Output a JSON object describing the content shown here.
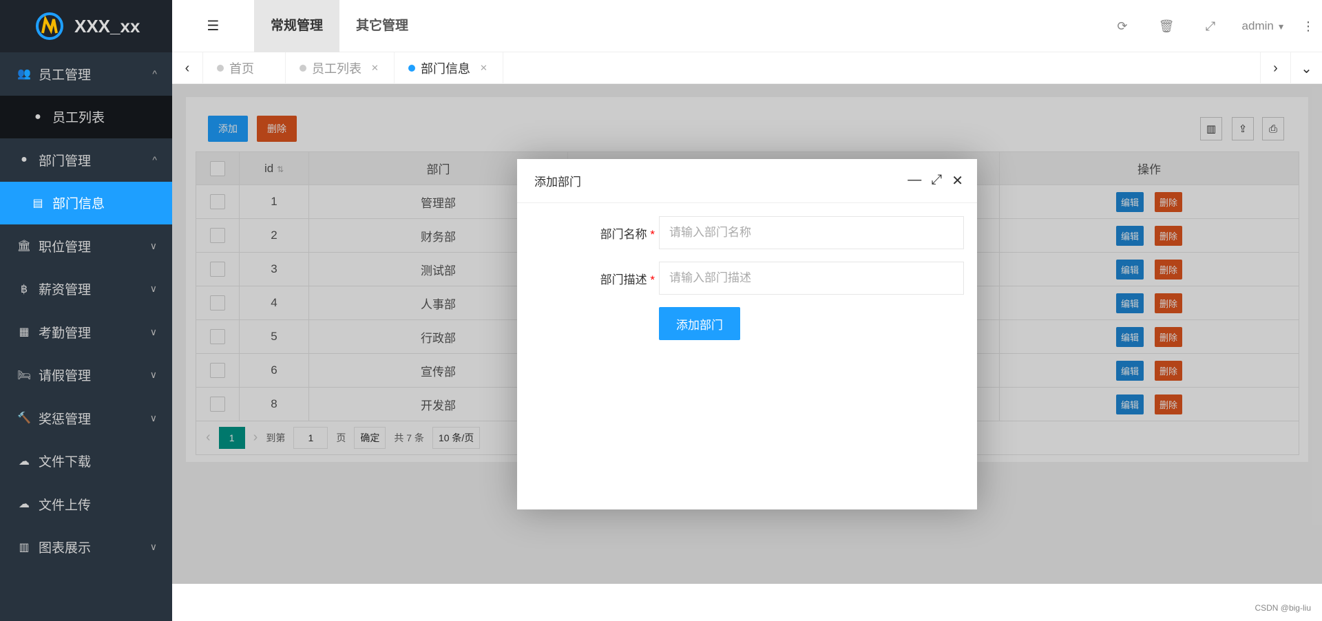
{
  "app": {
    "title": "XXX_xx"
  },
  "sidebar": {
    "items": [
      {
        "label": "员工管理",
        "icon": "users-icon",
        "glyph": "👥",
        "chevron": "^",
        "sub": false
      },
      {
        "label": "员工列表",
        "icon": "user-icon",
        "glyph": "●",
        "sub": true
      },
      {
        "label": "部门管理",
        "icon": "user-icon",
        "glyph": "●",
        "chevron": "^",
        "sub": false
      },
      {
        "label": "部门信息",
        "icon": "list-icon",
        "glyph": "▤",
        "sub": true,
        "active": true
      },
      {
        "label": "职位管理",
        "icon": "bank-icon",
        "glyph": "🏛",
        "chevron": "∨"
      },
      {
        "label": "薪资管理",
        "icon": "bitcoin-icon",
        "glyph": "฿",
        "chevron": "∨"
      },
      {
        "label": "考勤管理",
        "icon": "calendar-icon",
        "glyph": "▦",
        "chevron": "∨"
      },
      {
        "label": "请假管理",
        "icon": "bed-icon",
        "glyph": "🛏",
        "chevron": "∨"
      },
      {
        "label": "奖惩管理",
        "icon": "gavel-icon",
        "glyph": "🔨",
        "chevron": "∨"
      },
      {
        "label": "文件下载",
        "icon": "cloud-download-icon",
        "glyph": "☁"
      },
      {
        "label": "文件上传",
        "icon": "cloud-upload-icon",
        "glyph": "☁"
      },
      {
        "label": "图表展示",
        "icon": "bar-chart-icon",
        "glyph": "▥",
        "chevron": "∨"
      }
    ]
  },
  "header": {
    "menu_tabs": [
      "常规管理",
      "其它管理"
    ],
    "user": "admin"
  },
  "tabs": [
    {
      "label": "首页",
      "closable": false
    },
    {
      "label": "员工列表",
      "closable": true
    },
    {
      "label": "部门信息",
      "closable": true,
      "active": true
    }
  ],
  "toolbar": {
    "add": "添加",
    "delete": "删除"
  },
  "table": {
    "columns": [
      "id",
      "部门",
      "",
      "操作"
    ],
    "rows": [
      [
        "1",
        "管理部"
      ],
      [
        "2",
        "财务部"
      ],
      [
        "3",
        "测试部"
      ],
      [
        "4",
        "人事部"
      ],
      [
        "5",
        "行政部"
      ],
      [
        "6",
        "宣传部"
      ],
      [
        "8",
        "开发部"
      ]
    ],
    "edit": "编辑",
    "remove": "删除"
  },
  "pager": {
    "current": "1",
    "goto": "到第",
    "page_value": "1",
    "page_unit": "页",
    "confirm": "确定",
    "total": "共 7 条",
    "per_page": "10 条/页"
  },
  "modal": {
    "title": "添加部门",
    "name_label": "部门名称",
    "name_placeholder": "请输入部门名称",
    "desc_label": "部门描述",
    "desc_placeholder": "请输入部门描述",
    "submit": "添加部门"
  },
  "colors": {
    "primary": "#1e9fff",
    "danger": "#e0551f",
    "edit": "#1e88d6",
    "pager_active": "#009688",
    "sidebar": "#28333e"
  },
  "watermark": "CSDN @big-liu"
}
